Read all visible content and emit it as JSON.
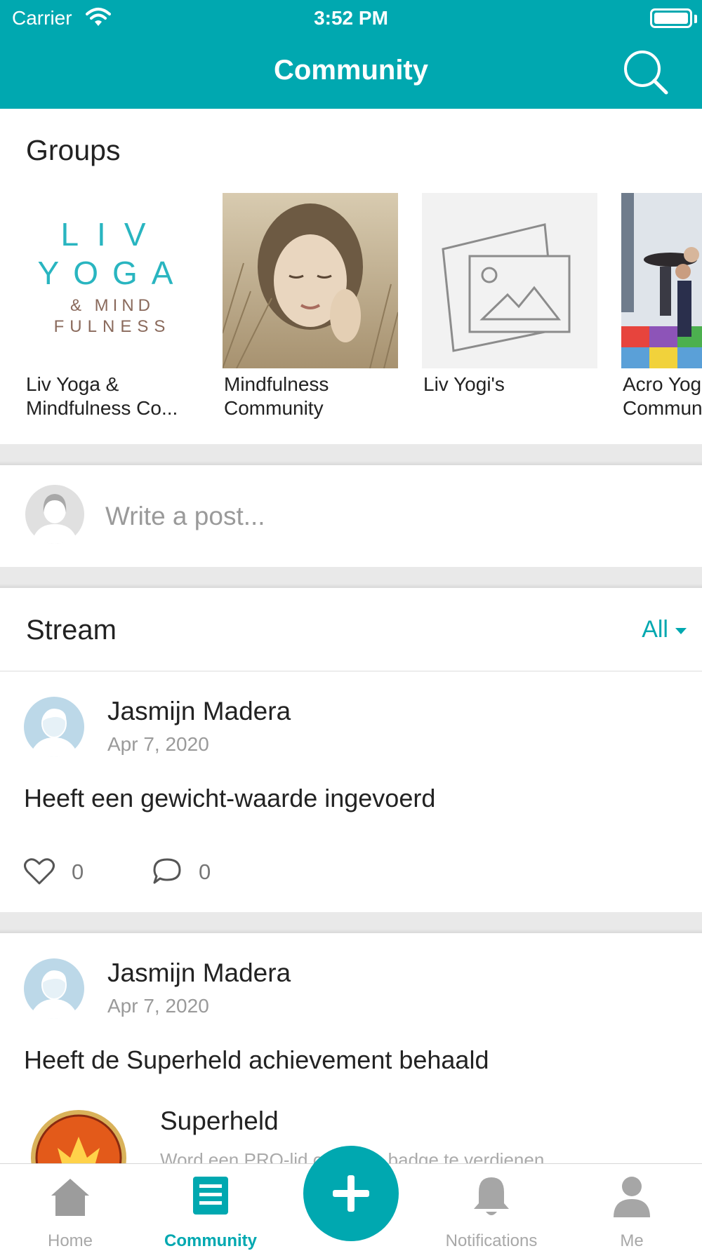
{
  "status_bar": {
    "carrier": "Carrier",
    "time": "3:52 PM"
  },
  "nav": {
    "title": "Community",
    "search_icon": "search-icon"
  },
  "groups": {
    "title": "Groups",
    "items": [
      {
        "name": "Liv Yoga &\nMindfulness Co...",
        "logo_line1": "LIV",
        "logo_line2": "YOGA",
        "logo_line3": "& MIND",
        "logo_line4": "FULNESS"
      },
      {
        "name": "Mindfulness\nCommunity"
      },
      {
        "name": "Liv Yogi's"
      },
      {
        "name": "Acro Yoga\nCommunity"
      }
    ]
  },
  "composer": {
    "placeholder": "Write a post..."
  },
  "stream": {
    "title": "Stream",
    "filter": "All",
    "posts": [
      {
        "author": "Jasmijn Madera",
        "date": "Apr 7, 2020",
        "text": "Heeft een gewicht-waarde ingevoerd",
        "likes": "0",
        "comments": "0"
      },
      {
        "author": "Jasmijn Madera",
        "date": "Apr 7, 2020",
        "text": "Heeft de Superheld achievement behaald",
        "achievement_title": "Superheld",
        "achievement_desc": "Word een PRO-lid om deze badge te verdienen"
      }
    ]
  },
  "tabbar": {
    "items": [
      {
        "label": "Home",
        "icon": "home-icon"
      },
      {
        "label": "Community",
        "icon": "community-icon"
      },
      {
        "label": "Notifications",
        "icon": "bell-icon"
      },
      {
        "label": "Me",
        "icon": "person-icon"
      }
    ],
    "fab_icon": "plus-icon"
  },
  "colors": {
    "accent": "#00a8b0",
    "separator": "#e9e9e9",
    "muted": "#9a9a9a",
    "logo_teal": "#29b5c0",
    "logo_brown": "#8a6a5c"
  }
}
